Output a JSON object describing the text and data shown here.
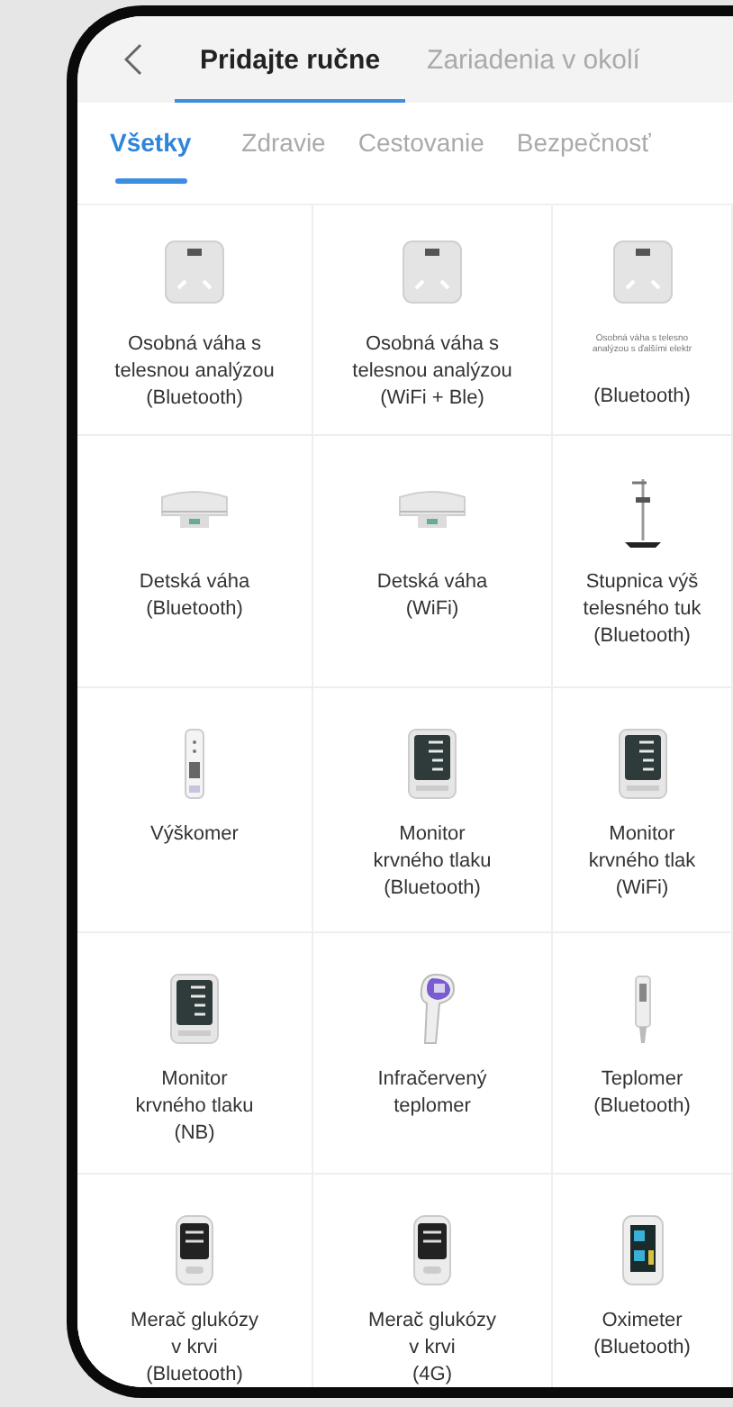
{
  "header": {
    "tabs": [
      {
        "label": "Pridajte ručne",
        "selected": true
      },
      {
        "label": "Zariadenia v okolí",
        "selected": false
      }
    ]
  },
  "categories": [
    {
      "label": "Všetky",
      "selected": true
    },
    {
      "label": "Zdravie",
      "selected": false
    },
    {
      "label": "Cestovanie",
      "selected": false
    },
    {
      "label": "Bezpečnosť",
      "selected": false
    }
  ],
  "devices": [
    {
      "kind": "body-scale",
      "label": "Osobná váha s\ntelesnou analýzou\n(Bluetooth)"
    },
    {
      "kind": "body-scale",
      "label": "Osobná váha s\ntelesnou analýzou\n(WiFi + Ble)"
    },
    {
      "kind": "body-scale",
      "note": "Osobná váha s telesno\nanalýzou s ďalšími elektr",
      "label": "(Bluetooth)"
    },
    {
      "kind": "baby-scale",
      "label": "Detská váha\n(Bluetooth)"
    },
    {
      "kind": "baby-scale",
      "label": "Detská váha\n(WiFi)"
    },
    {
      "kind": "height-scale",
      "label": "Stupnica výš\ntelesného tuk\n(Bluetooth)"
    },
    {
      "kind": "height-meter",
      "label": "Výškomer"
    },
    {
      "kind": "bp-monitor",
      "label": "Monitor\nkrvného tlaku\n(Bluetooth)"
    },
    {
      "kind": "bp-monitor",
      "label": "Monitor\nkrvného tlak\n(WiFi)"
    },
    {
      "kind": "bp-monitor",
      "label": "Monitor\nkrvného tlaku\n(NB)"
    },
    {
      "kind": "ir-thermometer",
      "label": "Infračervený\nteplomer"
    },
    {
      "kind": "pen-thermometer",
      "label": "Teplomer\n(Bluetooth)"
    },
    {
      "kind": "glucose-meter",
      "label": "Merač glukózy\nv krvi\n(Bluetooth)"
    },
    {
      "kind": "glucose-meter",
      "label": "Merač glukózy\nv krvi\n(4G)"
    },
    {
      "kind": "oximeter",
      "label": "Oximeter\n(Bluetooth)"
    }
  ]
}
